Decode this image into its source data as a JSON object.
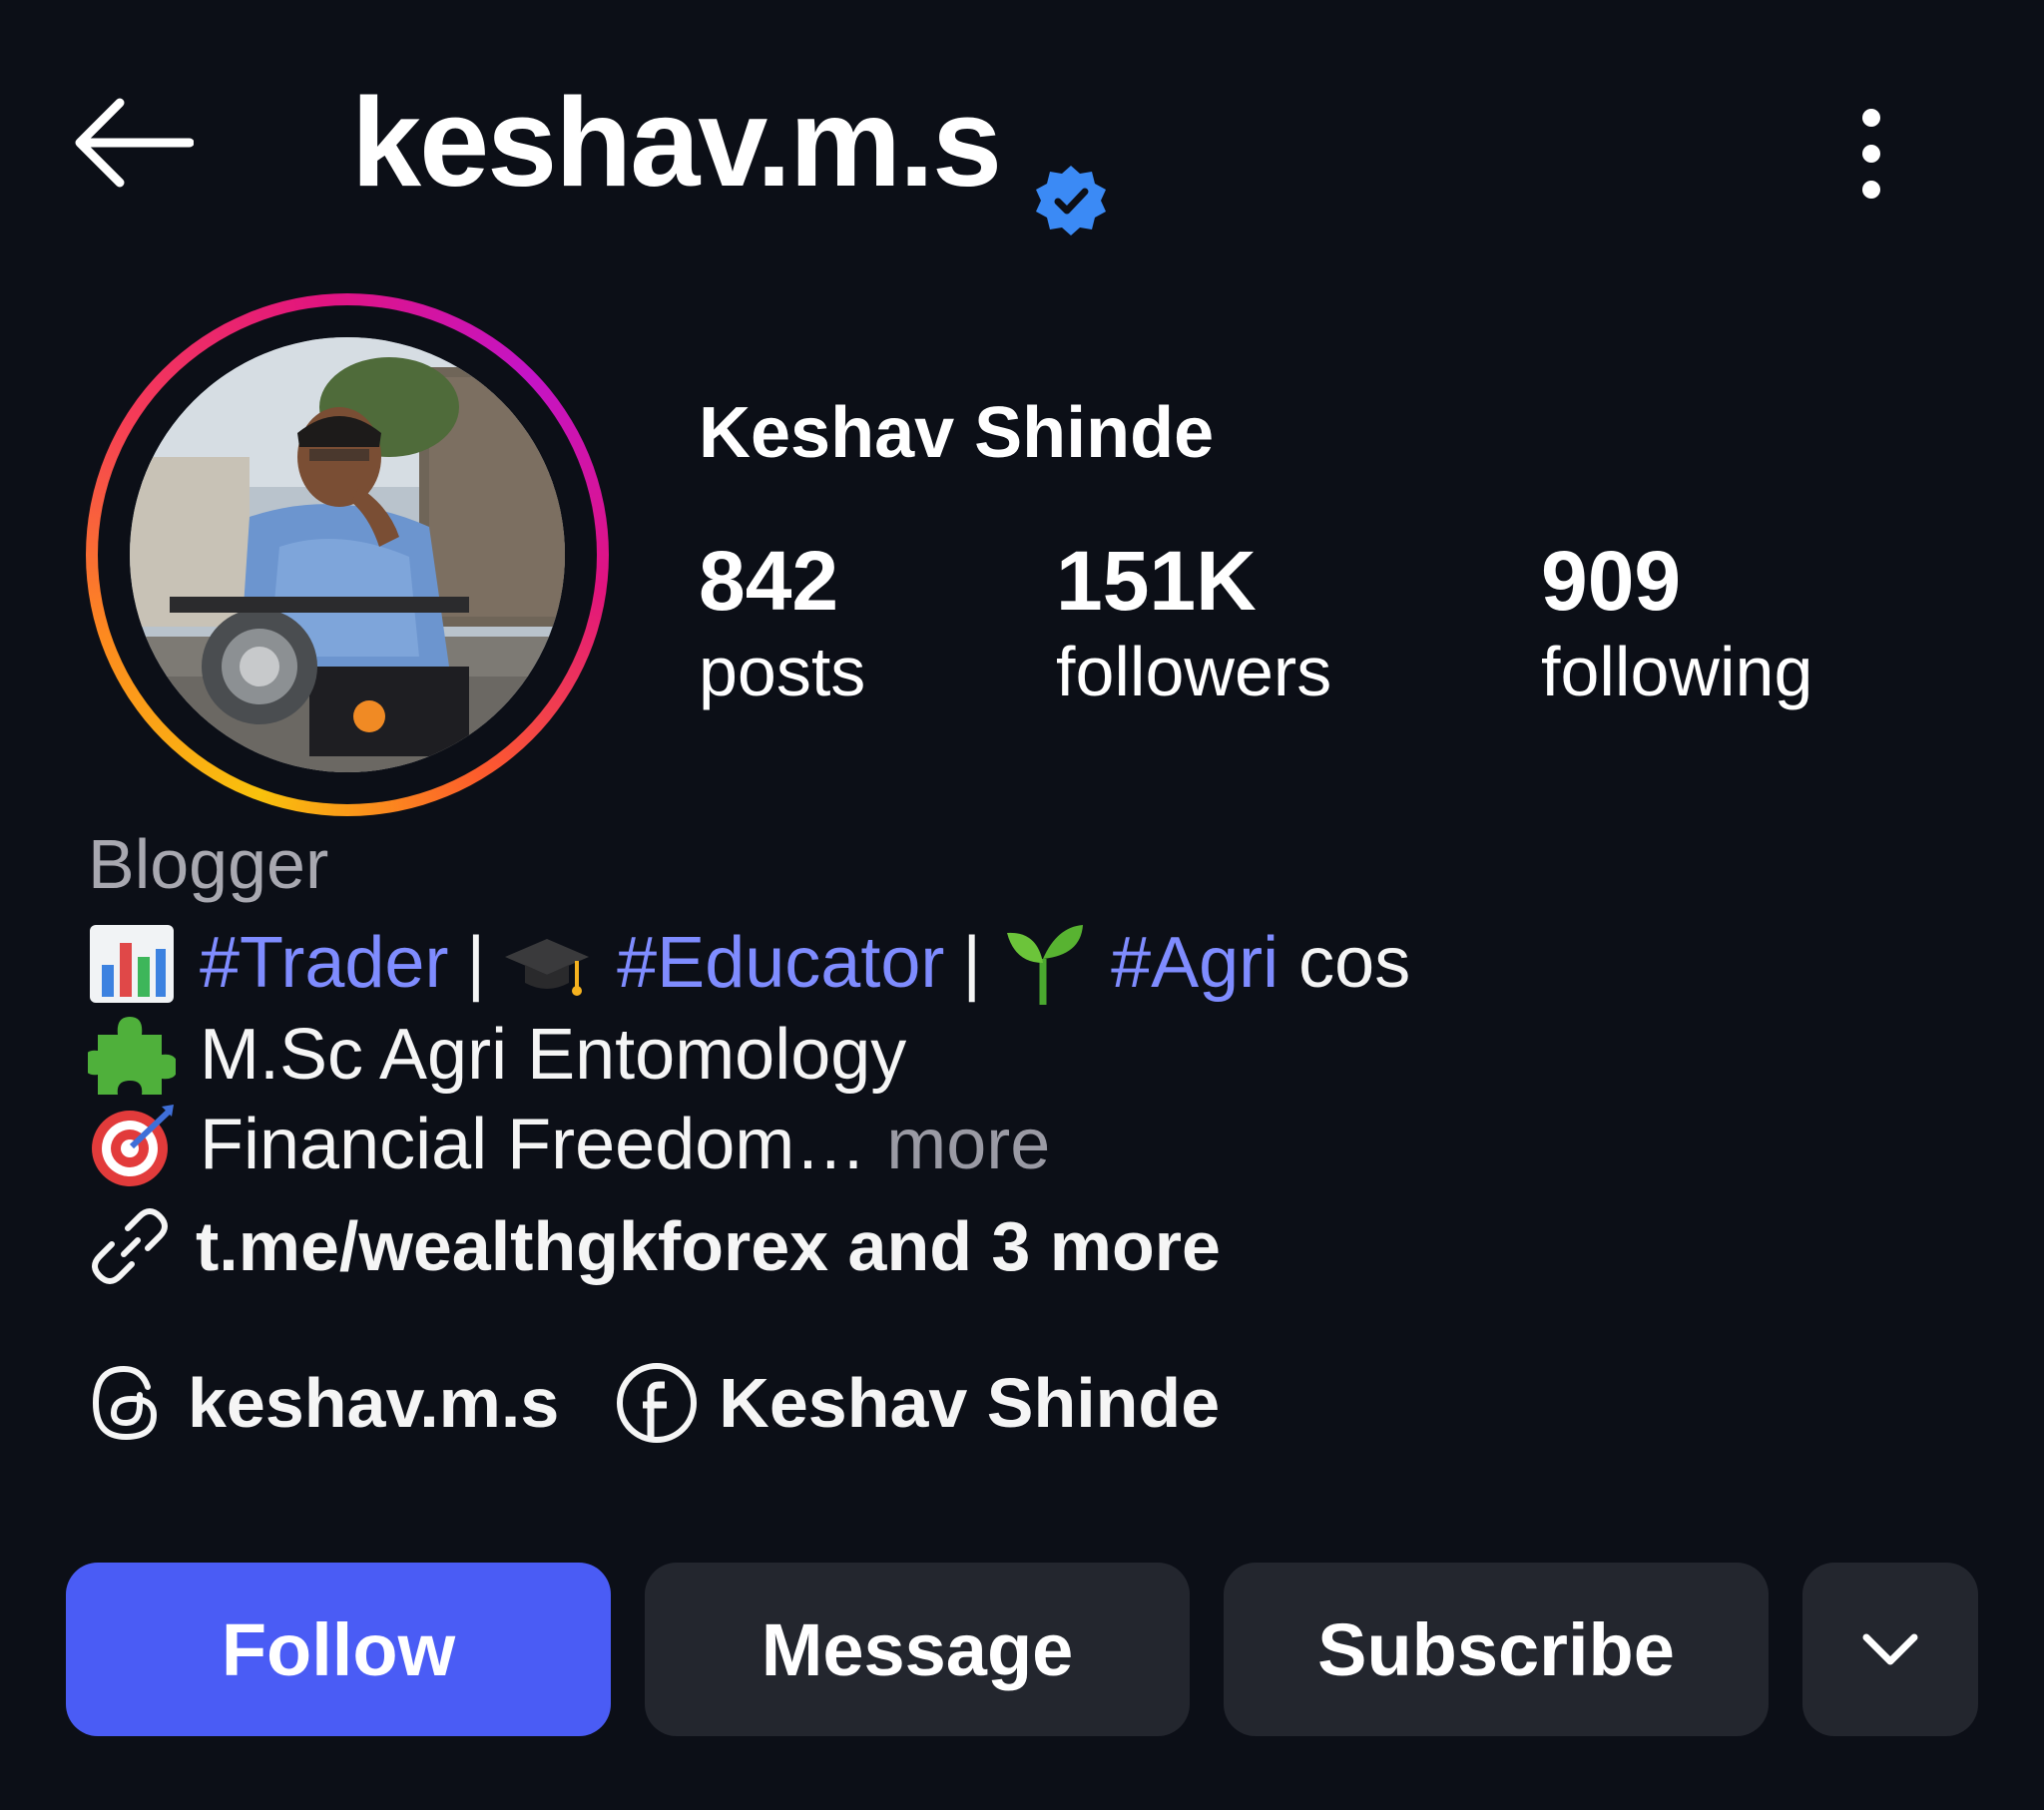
{
  "header": {
    "username": "keshav.m.s",
    "back_icon": "arrow-left-icon",
    "verified_icon": "verified-badge-icon",
    "more_icon": "more-vertical-icon"
  },
  "profile": {
    "full_name": "Keshav Shinde",
    "stats": [
      {
        "value": "842",
        "label": "posts"
      },
      {
        "value": "151K",
        "label": "followers"
      },
      {
        "value": "909",
        "label": "following"
      }
    ]
  },
  "bio": {
    "category": "Blogger",
    "line1": {
      "tag1": "#Trader",
      "sep1": "|",
      "tag2": "#Educator",
      "sep2": "|",
      "tag3": "#Agri",
      "suffix": "cos"
    },
    "line2": "M.Sc Agri Entomology",
    "line3": "Financial Freedom…",
    "line3_more": "more",
    "link": "t.me/wealthgkforex and 3 more"
  },
  "social": {
    "threads_handle": "keshav.m.s",
    "facebook_name": "Keshav Shinde"
  },
  "actions": {
    "follow": "Follow",
    "message": "Message",
    "subscribe": "Subscribe"
  },
  "colors": {
    "background": "#0c0f17",
    "accent": "#4a5cf5",
    "hashtag": "#7f8cff",
    "verified": "#3b8af5"
  }
}
